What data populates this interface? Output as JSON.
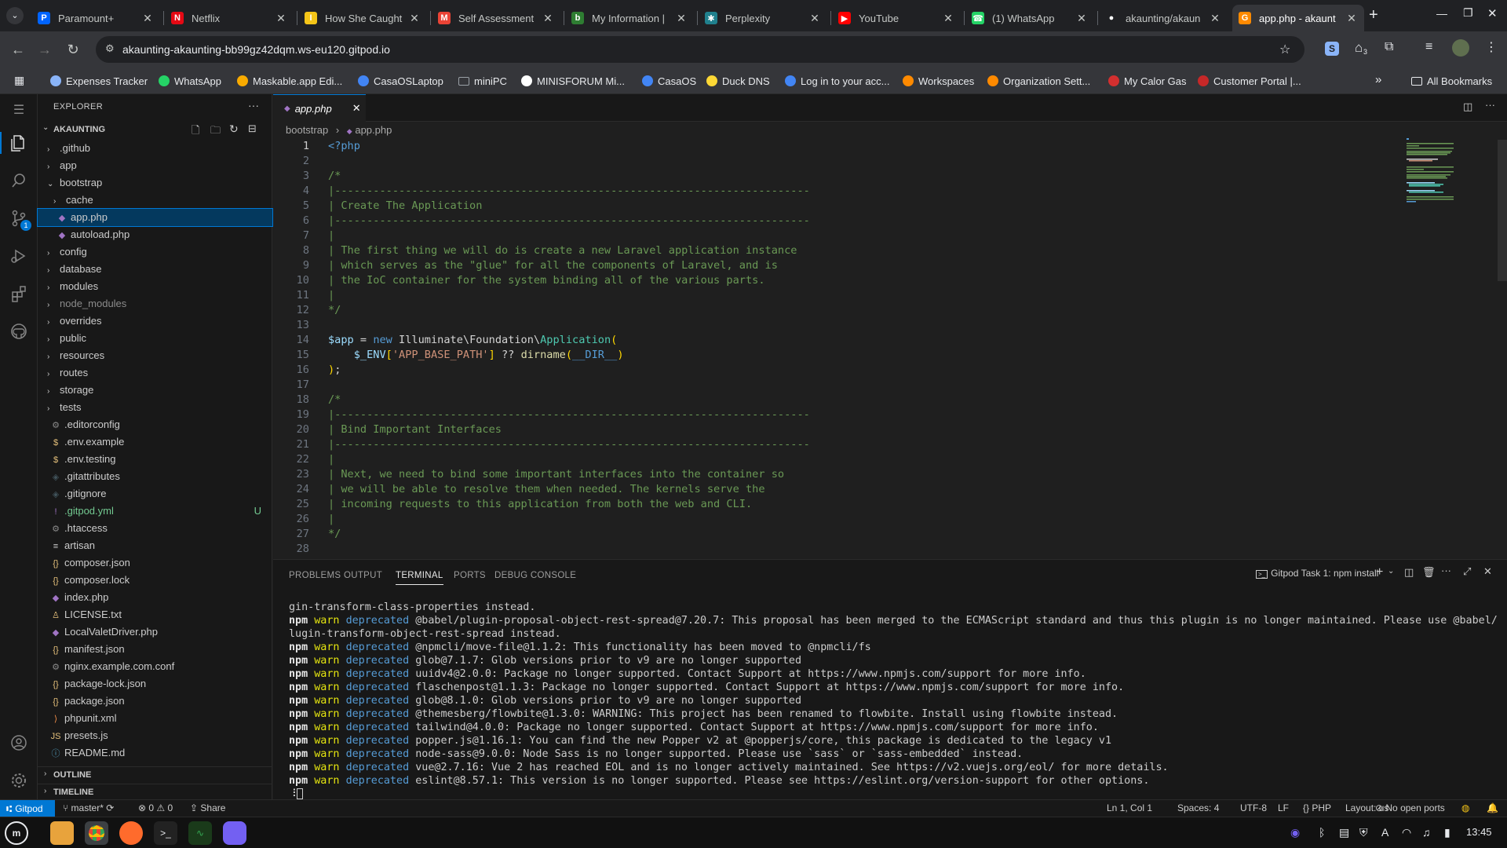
{
  "browser": {
    "tabs": [
      {
        "title": "Paramount+",
        "color": "#0064ff",
        "glyph": "P"
      },
      {
        "title": "Netflix",
        "color": "#e50914",
        "glyph": "N"
      },
      {
        "title": "How She Caught",
        "color": "#f5c518",
        "glyph": "I"
      },
      {
        "title": "Self Assessment",
        "color": "#ea4335",
        "glyph": "M"
      },
      {
        "title": "My Information |",
        "color": "#2e7d32",
        "glyph": "b"
      },
      {
        "title": "Perplexity",
        "color": "#20808d",
        "glyph": "✱"
      },
      {
        "title": "YouTube",
        "color": "#ff0000",
        "glyph": "▶"
      },
      {
        "title": "(1) WhatsApp",
        "color": "#25d366",
        "glyph": "☎"
      },
      {
        "title": "akaunting/akaun",
        "color": "#ffffff",
        "glyph": "●"
      },
      {
        "title": "app.php - akaunt",
        "color": "#ff8a00",
        "glyph": "G",
        "active": true
      }
    ],
    "url": "akaunting-akaunting-bb99gz42dqm.ws-eu120.gitpod.io",
    "extension_badge": "3",
    "bookmarks": [
      {
        "label": "Expenses Tracker",
        "color": "#8ab4f8"
      },
      {
        "label": "WhatsApp",
        "color": "#25d366"
      },
      {
        "label": "Maskable.app Edi...",
        "color": "#f9ab00"
      },
      {
        "label": "CasaOSLaptop",
        "color": "#4285f4"
      },
      {
        "label": "miniPC",
        "color": "#9aa0a6"
      },
      {
        "label": "MINISFORUM Mi...",
        "color": "#ffffff"
      },
      {
        "label": "CasaOS",
        "color": "#4285f4"
      },
      {
        "label": "Duck DNS",
        "color": "#fdd835"
      },
      {
        "label": "Log in to your acc...",
        "color": "#4285f4"
      },
      {
        "label": "Workspaces",
        "color": "#ff8a00"
      },
      {
        "label": "Organization Sett...",
        "color": "#ff8a00"
      },
      {
        "label": "My Calor Gas",
        "color": "#d32f2f"
      },
      {
        "label": "Customer Portal |...",
        "color": "#c62828"
      }
    ],
    "more_label": "»",
    "all_bookmarks": "All Bookmarks"
  },
  "explorer": {
    "header": "EXPLORER",
    "root": "AKAUNTING",
    "items": [
      {
        "label": ".github",
        "kind": "folder",
        "depth": 0,
        "open": false
      },
      {
        "label": "app",
        "kind": "folder",
        "depth": 0,
        "open": false
      },
      {
        "label": "bootstrap",
        "kind": "folder",
        "depth": 0,
        "open": true
      },
      {
        "label": "cache",
        "kind": "folder",
        "depth": 1,
        "open": false
      },
      {
        "label": "app.php",
        "kind": "php",
        "depth": 1,
        "selected": true
      },
      {
        "label": "autoload.php",
        "kind": "php",
        "depth": 1
      },
      {
        "label": "config",
        "kind": "folder",
        "depth": 0
      },
      {
        "label": "database",
        "kind": "folder",
        "depth": 0
      },
      {
        "label": "modules",
        "kind": "folder",
        "depth": 0
      },
      {
        "label": "node_modules",
        "kind": "folder",
        "depth": 0,
        "dim": true
      },
      {
        "label": "overrides",
        "kind": "folder",
        "depth": 0
      },
      {
        "label": "public",
        "kind": "folder",
        "depth": 0
      },
      {
        "label": "resources",
        "kind": "folder",
        "depth": 0
      },
      {
        "label": "routes",
        "kind": "folder",
        "depth": 0
      },
      {
        "label": "storage",
        "kind": "folder",
        "depth": 0
      },
      {
        "label": "tests",
        "kind": "folder",
        "depth": 0
      },
      {
        "label": ".editorconfig",
        "kind": "gear"
      },
      {
        "label": ".env.example",
        "kind": "env"
      },
      {
        "label": ".env.testing",
        "kind": "env"
      },
      {
        "label": ".gitattributes",
        "kind": "git"
      },
      {
        "label": ".gitignore",
        "kind": "git"
      },
      {
        "label": ".gitpod.yml",
        "kind": "yml",
        "badge": "U"
      },
      {
        "label": ".htaccess",
        "kind": "gear"
      },
      {
        "label": "artisan",
        "kind": "text"
      },
      {
        "label": "composer.json",
        "kind": "json"
      },
      {
        "label": "composer.lock",
        "kind": "json"
      },
      {
        "label": "index.php",
        "kind": "php"
      },
      {
        "label": "LICENSE.txt",
        "kind": "license"
      },
      {
        "label": "LocalValetDriver.php",
        "kind": "php"
      },
      {
        "label": "manifest.json",
        "kind": "json"
      },
      {
        "label": "nginx.example.com.conf",
        "kind": "gear"
      },
      {
        "label": "package-lock.json",
        "kind": "json"
      },
      {
        "label": "package.json",
        "kind": "json"
      },
      {
        "label": "phpunit.xml",
        "kind": "xml"
      },
      {
        "label": "presets.js",
        "kind": "js"
      },
      {
        "label": "README.md",
        "kind": "info"
      }
    ],
    "outline": "OUTLINE",
    "timeline": "TIMELINE"
  },
  "editor": {
    "tab": "app.php",
    "breadcrumb": [
      "bootstrap",
      "app.php"
    ],
    "lines": [
      [
        [
          "kw",
          "<?php"
        ]
      ],
      [],
      [
        [
          "cm",
          "/*"
        ]
      ],
      [
        [
          "cm",
          "|--------------------------------------------------------------------------"
        ]
      ],
      [
        [
          "cm",
          "| Create The Application"
        ]
      ],
      [
        [
          "cm",
          "|--------------------------------------------------------------------------"
        ]
      ],
      [
        [
          "cm",
          "|"
        ]
      ],
      [
        [
          "cm",
          "| The first thing we will do is create a new Laravel application instance"
        ]
      ],
      [
        [
          "cm",
          "| which serves as the \"glue\" for all the components of Laravel, and is"
        ]
      ],
      [
        [
          "cm",
          "| the IoC container for the system binding all of the various parts."
        ]
      ],
      [
        [
          "cm",
          "|"
        ]
      ],
      [
        [
          "cm",
          "*/"
        ]
      ],
      [],
      [
        [
          "va",
          "$app"
        ],
        [
          "df",
          " = "
        ],
        [
          "kw",
          "new"
        ],
        [
          "df",
          " Illuminate\\Foundation\\"
        ],
        [
          "cl",
          "Application"
        ],
        [
          "pu",
          "("
        ]
      ],
      [
        [
          "df",
          "    "
        ],
        [
          "va",
          "$_ENV"
        ],
        [
          "pu",
          "["
        ],
        [
          "st",
          "'APP_BASE_PATH'"
        ],
        [
          "pu",
          "]"
        ],
        [
          "df",
          " ?? "
        ],
        [
          "fn",
          "dirname"
        ],
        [
          "pu",
          "("
        ],
        [
          "dir",
          "__DIR__"
        ],
        [
          "pu",
          ")"
        ]
      ],
      [
        [
          "pu",
          ")"
        ],
        [
          "df",
          ";"
        ]
      ],
      [],
      [
        [
          "cm",
          "/*"
        ]
      ],
      [
        [
          "cm",
          "|--------------------------------------------------------------------------"
        ]
      ],
      [
        [
          "cm",
          "| Bind Important Interfaces"
        ]
      ],
      [
        [
          "cm",
          "|--------------------------------------------------------------------------"
        ]
      ],
      [
        [
          "cm",
          "|"
        ]
      ],
      [
        [
          "cm",
          "| Next, we need to bind some important interfaces into the container so"
        ]
      ],
      [
        [
          "cm",
          "| we will be able to resolve them when needed. The kernels serve the"
        ]
      ],
      [
        [
          "cm",
          "| incoming requests to this application from both the web and CLI."
        ]
      ],
      [
        [
          "cm",
          "|"
        ]
      ],
      [
        [
          "cm",
          "*/"
        ]
      ],
      []
    ]
  },
  "panel": {
    "tabs": [
      "PROBLEMS",
      "OUTPUT",
      "TERMINAL",
      "PORTS",
      "DEBUG CONSOLE"
    ],
    "active_tab": "TERMINAL",
    "terminal_name": "Gitpod Task 1: npm install",
    "lines": [
      [
        "",
        "",
        "gin-transform-class-properties instead."
      ],
      [
        "npm",
        "warn",
        "deprecated",
        "@babel/plugin-proposal-object-rest-spread@7.20.7: This proposal has been merged to the ECMAScript standard and thus this plugin is no longer maintained. Please use @babel/p"
      ],
      [
        "",
        "",
        "lugin-transform-object-rest-spread instead."
      ],
      [
        "npm",
        "warn",
        "deprecated",
        "@npmcli/move-file@1.1.2: This functionality has been moved to @npmcli/fs"
      ],
      [
        "npm",
        "warn",
        "deprecated",
        "glob@7.1.7: Glob versions prior to v9 are no longer supported"
      ],
      [
        "npm",
        "warn",
        "deprecated",
        "uuidv4@2.0.0: Package no longer supported. Contact Support at https://www.npmjs.com/support for more info."
      ],
      [
        "npm",
        "warn",
        "deprecated",
        "flaschenpost@1.1.3: Package no longer supported. Contact Support at https://www.npmjs.com/support for more info."
      ],
      [
        "npm",
        "warn",
        "deprecated",
        "glob@8.1.0: Glob versions prior to v9 are no longer supported"
      ],
      [
        "npm",
        "warn",
        "deprecated",
        "@themesberg/flowbite@1.3.0: WARNING: This project has been renamed to flowbite. Install using flowbite instead."
      ],
      [
        "npm",
        "warn",
        "deprecated",
        "tailwind@4.0.0: Package no longer supported. Contact Support at https://www.npmjs.com/support for more info."
      ],
      [
        "npm",
        "warn",
        "deprecated",
        "popper.js@1.16.1: You can find the new Popper v2 at @popperjs/core, this package is dedicated to the legacy v1"
      ],
      [
        "npm",
        "warn",
        "deprecated",
        "node-sass@9.0.0: Node Sass is no longer supported. Please use `sass` or `sass-embedded` instead."
      ],
      [
        "npm",
        "warn",
        "deprecated",
        "vue@2.7.16: Vue 2 has reached EOL and is no longer actively maintained. See https://v2.vuejs.org/eol/ for more details."
      ],
      [
        "npm",
        "warn",
        "deprecated",
        "eslint@8.57.1: This version is no longer supported. Please see https://eslint.org/version-support for other options."
      ]
    ],
    "prompt": "⠸"
  },
  "status": {
    "remote": "Gitpod",
    "branch": "master*",
    "problems": "⊗ 0 ⚠ 0",
    "share": "Share",
    "position": "Ln 1, Col 1",
    "spaces": "Spaces: 4",
    "encoding": "UTF-8",
    "eol": "LF",
    "language": "PHP",
    "layout": "Layout: us",
    "ports": "No open ports"
  },
  "taskbar": {
    "time": "13:45"
  }
}
